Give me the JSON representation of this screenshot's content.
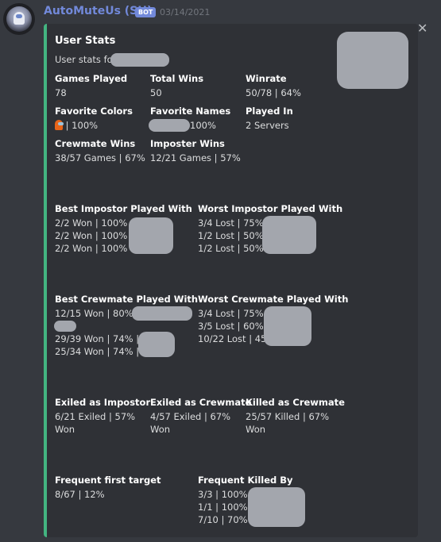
{
  "message": {
    "username": "AutoMuteUs (SH)",
    "bot_tag": "BOT",
    "timestamp": "03/14/2021"
  },
  "embed": {
    "title": "User Stats",
    "description": "User stats for",
    "accent_color": "#43b581",
    "fields": {
      "games_played": {
        "name": "Games Played",
        "value": "78"
      },
      "total_wins": {
        "name": "Total Wins",
        "value": "50"
      },
      "winrate": {
        "name": "Winrate",
        "value": "50/78 | 64%"
      },
      "favorite_colors": {
        "name": "Favorite Colors",
        "value": "| 100%"
      },
      "favorite_names": {
        "name": "Favorite Names",
        "value": "100%"
      },
      "played_in": {
        "name": "Played In",
        "value": "2 Servers"
      },
      "crewmate_wins": {
        "name": "Crewmate Wins",
        "value": "38/57 Games | 67%"
      },
      "imposter_wins": {
        "name": "Imposter Wins",
        "value": "12/21 Games | 57%"
      },
      "best_impostor": {
        "name": "Best Impostor Played With",
        "lines": [
          "2/2 Won | 100%",
          "2/2 Won | 100%",
          "2/2 Won | 100%"
        ]
      },
      "worst_impostor": {
        "name": "Worst Impostor Played With",
        "lines": [
          "3/4 Lost | 75%",
          "1/2 Lost | 50%",
          "1/2 Lost | 50%"
        ]
      },
      "best_crewmate": {
        "name": "Best Crewmate Played With",
        "lines": [
          "12/15 Won | 80%",
          "29/39 Won | 74% |",
          "25/34 Won | 74% |"
        ]
      },
      "worst_crewmate": {
        "name": "Worst Crewmate Played With",
        "lines": [
          "3/4 Lost | 75%",
          "3/5 Lost | 60%",
          "10/22 Lost | 45%"
        ]
      },
      "exiled_impostor": {
        "name": "Exiled as Impostor",
        "lines": [
          "6/21 Exiled | 57%",
          "Won"
        ]
      },
      "exiled_crewmate": {
        "name": "Exiled as Crewmate",
        "lines": [
          "4/57 Exiled | 67%",
          "Won"
        ]
      },
      "killed_crewmate": {
        "name": "Killed as Crewmate",
        "lines": [
          "25/57 Killed | 67%",
          "Won"
        ]
      },
      "frequent_first_target": {
        "name": "Frequent first target",
        "value": "8/67 | 12%"
      },
      "frequent_killed_by": {
        "name": "Frequent Killed By",
        "lines": [
          "3/3 | 100%",
          "1/1 | 100%",
          "7/10 | 70%"
        ]
      }
    }
  },
  "icons": {
    "close": "close-icon",
    "avatar": "bot-avatar",
    "color_swatch": "crewmate-orange-icon"
  },
  "close_glyph": "✕"
}
